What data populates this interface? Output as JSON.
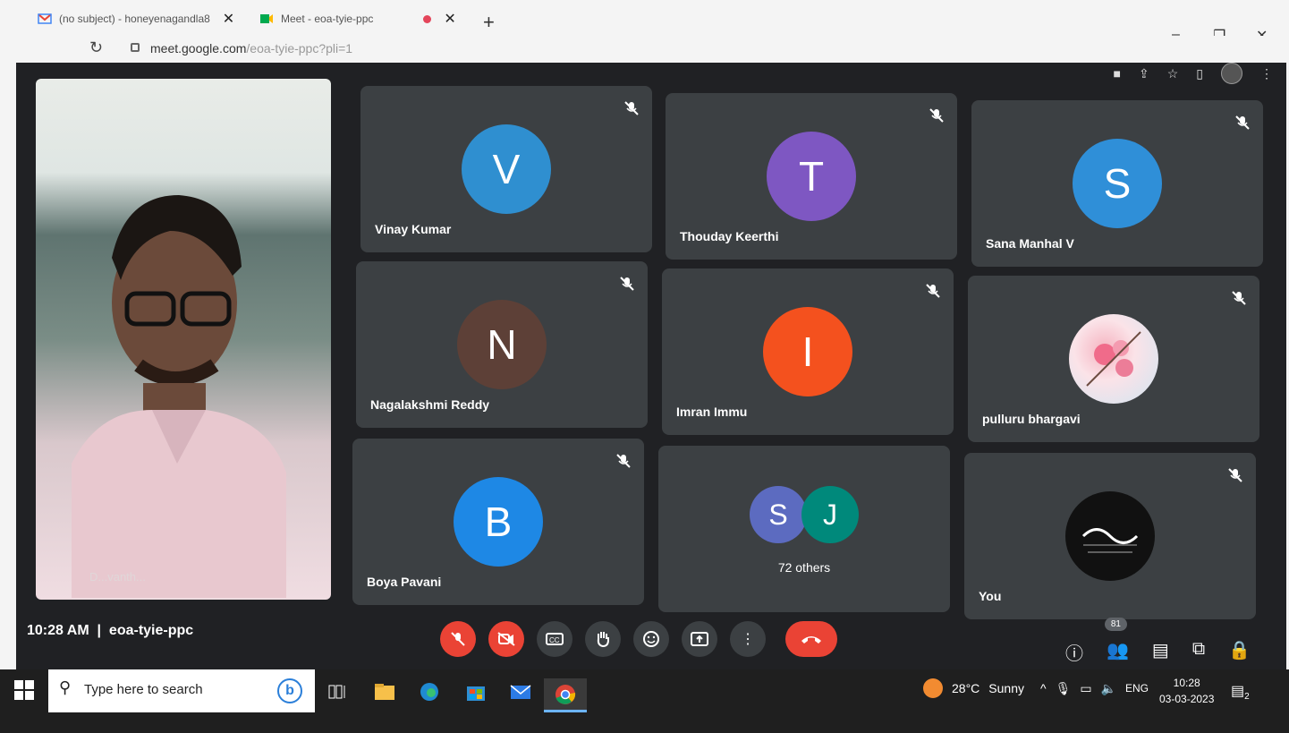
{
  "browser": {
    "tabs": [
      {
        "label": "(no subject) - honeyenagandla8",
        "icon": "gmail-icon"
      },
      {
        "label": "Meet - eoa-tyie-ppc",
        "icon": "meet-icon",
        "recording": true
      }
    ],
    "url_host": "meet.google.com",
    "url_path": "/eoa-tyie-ppc?pli=1"
  },
  "meet": {
    "self_name": "D...vanth...",
    "tiles": [
      {
        "name": "Vinay Kumar",
        "initial": "V",
        "color": "#2f8fd0"
      },
      {
        "name": "Thouday Keerthi",
        "initial": "T",
        "color": "#7e57c2"
      },
      {
        "name": "Sana Manhal V",
        "initial": "S",
        "color": "#2f8fd8"
      },
      {
        "name": "Nagalakshmi Reddy",
        "initial": "N",
        "color": "#5d4037"
      },
      {
        "name": "Imran Immu",
        "initial": "I",
        "color": "#f4511e"
      },
      {
        "name": "pulluru bhargavi",
        "initial": "",
        "color": "#f6d9df"
      },
      {
        "name": "Boya Pavani",
        "initial": "B",
        "color": "#1e88e5"
      },
      {
        "name": "You",
        "initial": "",
        "color": "#111111"
      }
    ],
    "others": {
      "initials": [
        "S",
        "J"
      ],
      "colors": [
        "#5c6bc0",
        "#00897b"
      ],
      "label": "72 others"
    },
    "time": "10:28 AM",
    "meeting_code": "eoa-tyie-ppc",
    "participant_count": "81"
  },
  "taskbar": {
    "search_placeholder": "Type here to search",
    "weather_temp": "28°C",
    "weather_desc": "Sunny",
    "lang": "ENG",
    "clock_time": "10:28",
    "clock_date": "03-03-2023",
    "notif_count": "2"
  }
}
